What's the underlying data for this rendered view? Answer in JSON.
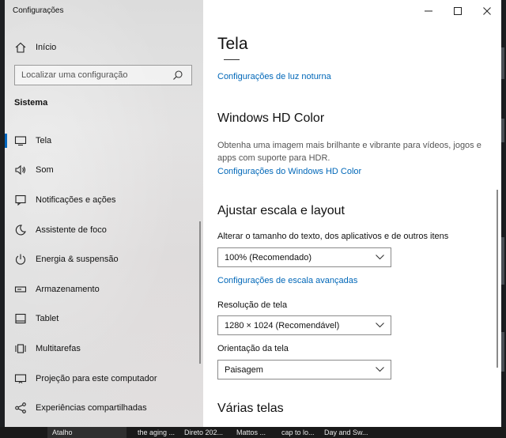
{
  "window": {
    "title": "Configurações"
  },
  "sidebar": {
    "home_label": "Início",
    "search_placeholder": "Localizar uma configuração",
    "section_title": "Sistema",
    "items": [
      {
        "label": "Tela",
        "icon": "monitor-icon",
        "active": true
      },
      {
        "label": "Som",
        "icon": "speaker-icon",
        "active": false
      },
      {
        "label": "Notificações e ações",
        "icon": "notification-icon",
        "active": false
      },
      {
        "label": "Assistente de foco",
        "icon": "moon-icon",
        "active": false
      },
      {
        "label": "Energia & suspensão",
        "icon": "power-icon",
        "active": false
      },
      {
        "label": "Armazenamento",
        "icon": "storage-icon",
        "active": false
      },
      {
        "label": "Tablet",
        "icon": "tablet-icon",
        "active": false
      },
      {
        "label": "Multitarefas",
        "icon": "multitask-icon",
        "active": false
      },
      {
        "label": "Projeção para este computador",
        "icon": "projection-icon",
        "active": false
      },
      {
        "label": "Experiências compartilhadas",
        "icon": "share-icon",
        "active": false
      }
    ]
  },
  "content": {
    "title": "Tela",
    "night_light_link": "Configurações de luz noturna",
    "hdr": {
      "heading": "Windows HD Color",
      "description": "Obtenha uma imagem mais brilhante e vibrante para vídeos, jogos e apps com suporte para HDR.",
      "link": "Configurações do Windows HD Color"
    },
    "scale": {
      "heading": "Ajustar escala e layout",
      "size_label": "Alterar o tamanho do texto, dos aplicativos e de outros itens",
      "size_value": "100% (Recomendado)",
      "advanced_link": "Configurações de escala avançadas",
      "resolution_label": "Resolução de tela",
      "resolution_value": "1280 × 1024 (Recomendável)",
      "orientation_label": "Orientação da tela",
      "orientation_value": "Paisagem"
    },
    "multi_heading": "Várias telas"
  },
  "taskbar": {
    "items": [
      "Atalho",
      "the aging ...",
      "Direto 202...",
      "Mattos ...",
      "cap to lo...",
      "Day and Sw..."
    ]
  },
  "colors": {
    "accent": "#0067c0",
    "link": "#0067b8"
  }
}
